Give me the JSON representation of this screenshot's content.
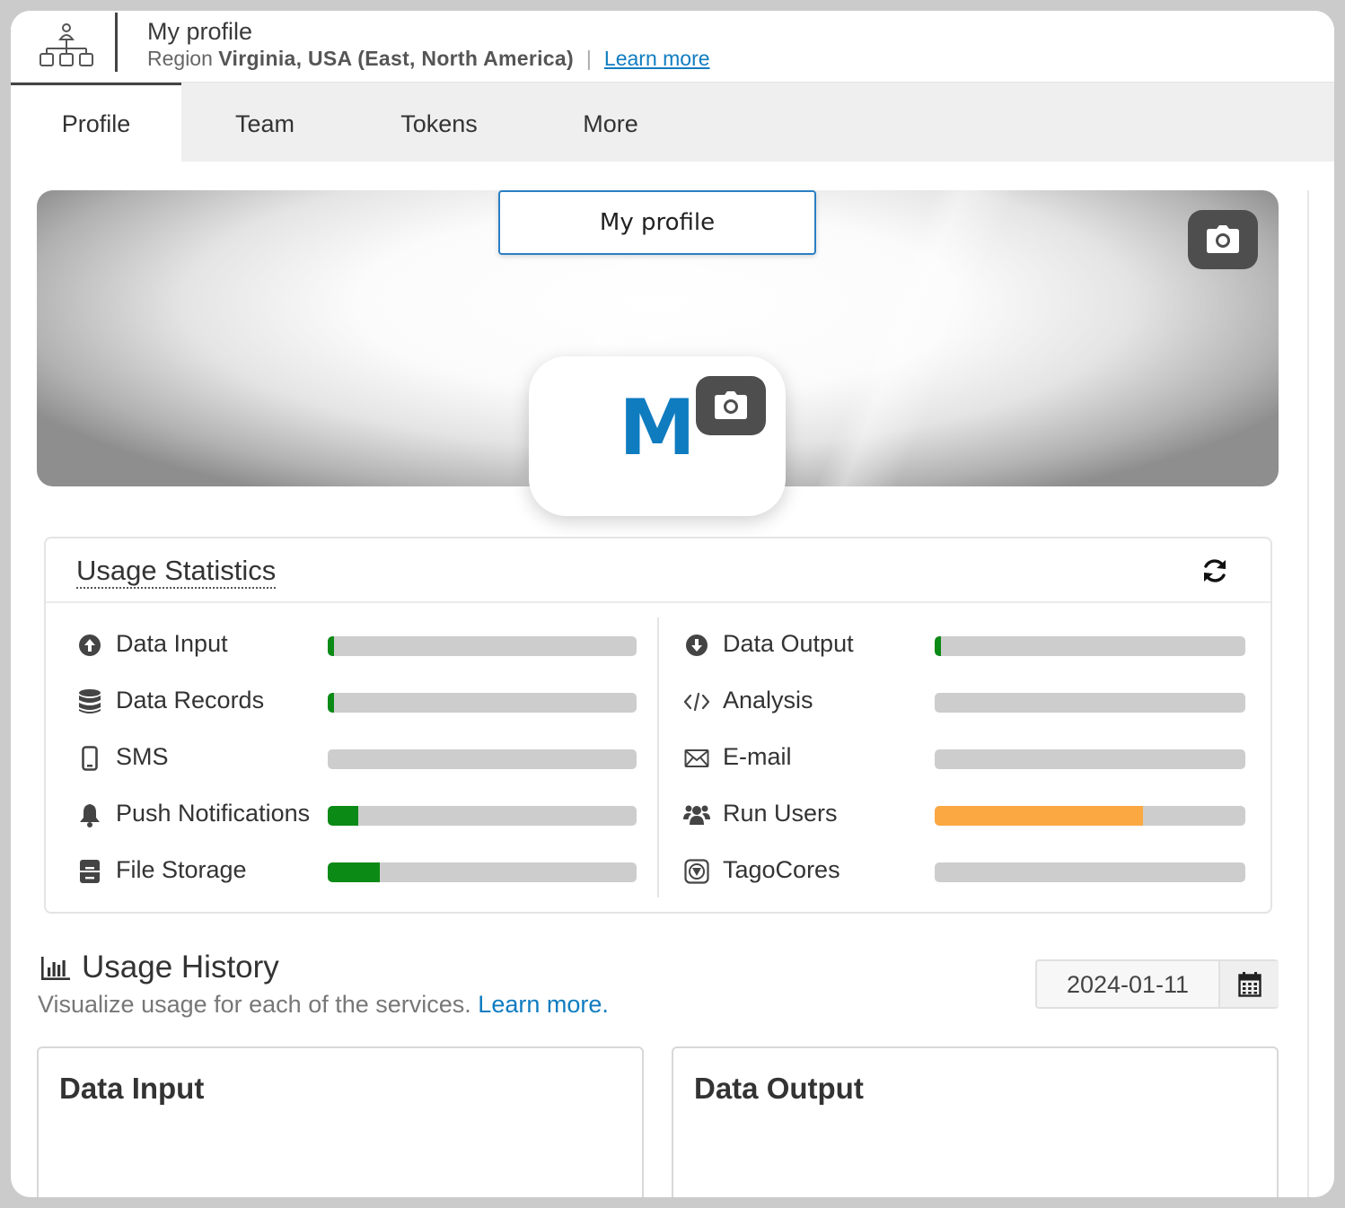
{
  "header": {
    "title": "My profile",
    "region_label": "Region",
    "region_value": "Virginia, USA (East, North America)",
    "separator": "|",
    "learn_more": "Learn more"
  },
  "tabs": [
    {
      "label": "Profile",
      "active": true
    },
    {
      "label": "Team",
      "active": false
    },
    {
      "label": "Tokens",
      "active": false
    },
    {
      "label": "More",
      "active": false
    }
  ],
  "profile": {
    "name_value": "My profile",
    "avatar_letter": "M"
  },
  "usage_statistics": {
    "title": "Usage Statistics",
    "left": [
      {
        "label": "Data Input",
        "icon": "arrow-circle-up-icon",
        "fill_percent": 2,
        "color": "#0b8a16"
      },
      {
        "label": "Data Records",
        "icon": "database-icon",
        "fill_percent": 2,
        "color": "#0b8a16"
      },
      {
        "label": "SMS",
        "icon": "mobile-phone-icon",
        "fill_percent": 0,
        "color": "#0b8a16"
      },
      {
        "label": "Push Notifications",
        "icon": "bell-icon",
        "fill_percent": 10,
        "color": "#0b8a16"
      },
      {
        "label": "File Storage",
        "icon": "file-storage-icon",
        "fill_percent": 17,
        "color": "#0b8a16"
      }
    ],
    "right": [
      {
        "label": "Data Output",
        "icon": "arrow-circle-down-icon",
        "fill_percent": 2,
        "color": "#0b8a16"
      },
      {
        "label": "Analysis",
        "icon": "code-icon",
        "fill_percent": 0,
        "color": "#0b8a16"
      },
      {
        "label": "E-mail",
        "icon": "envelope-icon",
        "fill_percent": 0,
        "color": "#0b8a16"
      },
      {
        "label": "Run Users",
        "icon": "users-icon",
        "fill_percent": 67,
        "color": "#fba843"
      },
      {
        "label": "TagoCores",
        "icon": "tagocore-icon",
        "fill_percent": 0,
        "color": "#0b8a16"
      }
    ]
  },
  "usage_history": {
    "title": "Usage History",
    "subtitle": "Visualize usage for each of the services.",
    "learn_more": "Learn more.",
    "date": "2024-01-11",
    "panels": [
      "Data Input",
      "Data Output"
    ]
  },
  "colors": {
    "accent": "#0f7cc0",
    "bar_track": "#cdcdcd",
    "bar_green": "#0b8a16",
    "bar_orange": "#fba843"
  }
}
